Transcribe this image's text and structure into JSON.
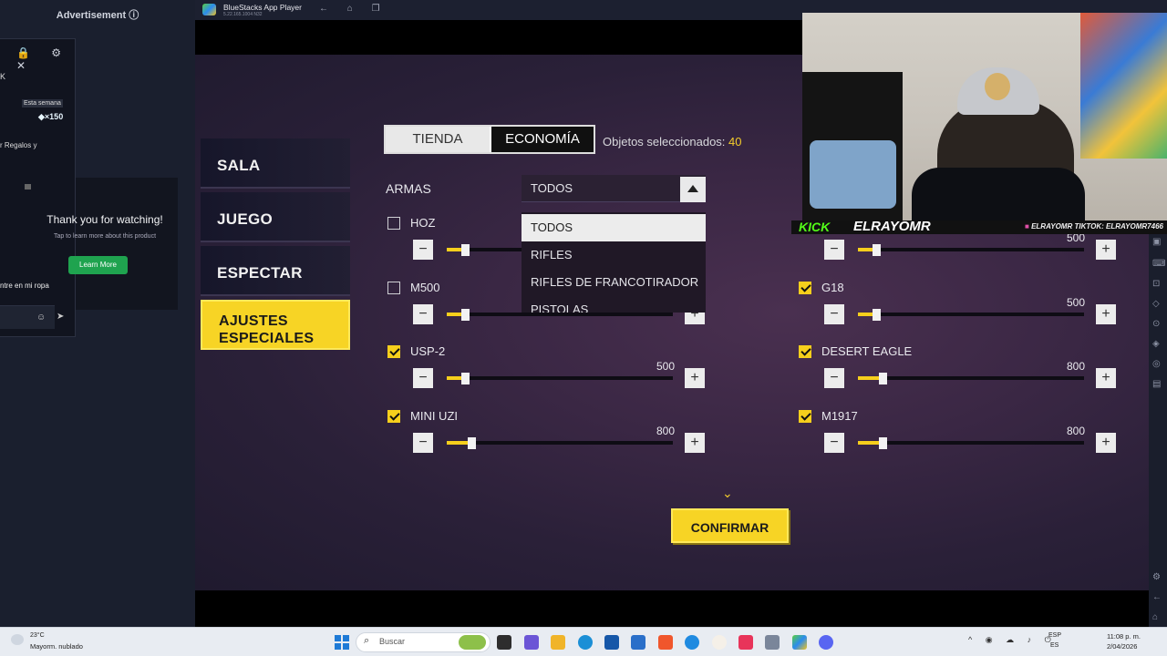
{
  "browser_ad": {
    "header": "Advertisement ⓘ",
    "chat_icons": "🔒 ⚙ ✕",
    "chat_letter": "K",
    "week_badge": "Esta semana",
    "gems": "◆×150",
    "gifts_text": "r Regalos y",
    "thanks": "Thank you for watching!",
    "sub": "Tap to learn more about this product",
    "learn_more": "Learn More",
    "chat_msg": "ntre en mi ropa",
    "emoji": "☺",
    "send": "➤"
  },
  "bluestacks": {
    "title": "BlueStacks App Player",
    "version": "5.22.165.1004 N32",
    "nav": "← ⌂ ❐"
  },
  "game": {
    "menu": [
      "SALA",
      "JUEGO",
      "ESPECTAR"
    ],
    "menu_active_line1": "AJUSTES",
    "menu_active_line2": "ESPECIALES",
    "tab_tienda": "TIENDA",
    "tab_economia": "ECONOMÍA",
    "selected_label": "Objetos seleccionados:",
    "selected_count": "40",
    "armas_label": "ARMAS",
    "dropdown_value": "TODOS",
    "dropdown_options": [
      "TODOS",
      "RIFLES",
      "RIFLES DE FRANCOTIRADOR",
      "PISTOLAS"
    ],
    "weapons_left": [
      {
        "name": "HOZ",
        "checked": false,
        "value": "",
        "fill": 0.08
      },
      {
        "name": "M500",
        "checked": false,
        "value": "",
        "fill": 0.08
      },
      {
        "name": "USP-2",
        "checked": true,
        "value": "500",
        "fill": 0.08
      },
      {
        "name": "MINI UZI",
        "checked": true,
        "value": "800",
        "fill": 0.11
      }
    ],
    "weapons_right": [
      {
        "name": "",
        "checked": false,
        "value": "500",
        "fill": 0.08,
        "hidden_name": true
      },
      {
        "name": "G18",
        "checked": true,
        "value": "500",
        "fill": 0.08
      },
      {
        "name": "DESERT EAGLE",
        "checked": true,
        "value": "800",
        "fill": 0.11
      },
      {
        "name": "M1917",
        "checked": true,
        "value": "800",
        "fill": 0.11
      }
    ],
    "minus": "−",
    "plus": "+",
    "chevron": "⌄",
    "confirm": "CONFIRMAR",
    "accent": "#f7d425"
  },
  "stream": {
    "kick": "KICK",
    "name": "ELRAYOMR",
    "info": "ELRAYOMR  TIKTOK: ELRAYOMR7466"
  },
  "taskbar": {
    "temp": "23°C",
    "weather": "Mayorm. nublado",
    "search": "Buscar",
    "tray": "^ ◉ ☁ ♪ ⏻",
    "lang1": "ESP",
    "lang2": "ES",
    "time": "11:08 p. m.",
    "date": "2/04/2026"
  }
}
